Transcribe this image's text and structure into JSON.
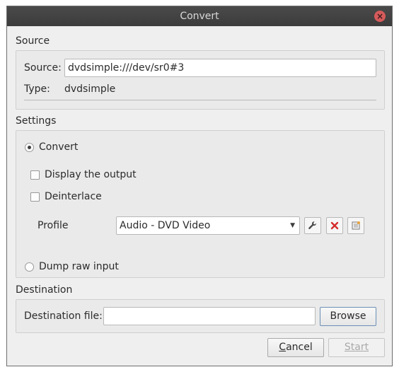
{
  "window": {
    "title": "Convert",
    "close_glyph": "×"
  },
  "source": {
    "section_label": "Source",
    "source_label": "Source:",
    "source_value": "dvdsimple:///dev/sr0#3",
    "type_label": "Type:",
    "type_value": "dvdsimple"
  },
  "settings": {
    "section_label": "Settings",
    "convert_label": "Convert",
    "convert_selected": true,
    "display_output_label": "Display the output",
    "display_output_checked": false,
    "deinterlace_label": "Deinterlace",
    "deinterlace_checked": false,
    "profile_label": "Profile",
    "profile_value": "Audio - DVD Video",
    "dump_raw_label": "Dump raw input",
    "dump_raw_selected": false
  },
  "destination": {
    "section_label": "Destination",
    "file_label": "Destination file:",
    "file_value": "",
    "browse_label": "Browse"
  },
  "footer": {
    "cancel_prefix": "",
    "cancel_mnemonic": "C",
    "cancel_rest": "ancel",
    "start_label": "Start"
  },
  "icons": {
    "edit_profile": "wrench-icon",
    "delete_profile": "delete-x-icon",
    "new_profile": "new-profile-icon"
  },
  "colors": {
    "titlebar": "#3c3c3c",
    "close": "#d65a5a",
    "delete": "#d62c2c"
  }
}
